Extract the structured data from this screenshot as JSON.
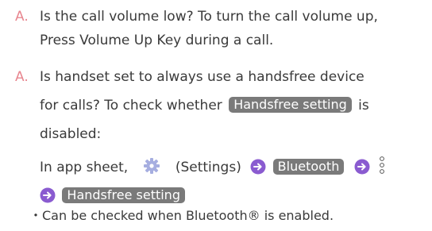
{
  "qa": [
    {
      "marker": "A.",
      "line1": "Is the call volume low? To turn the call volume up,",
      "line2": "Press Volume Up Key during a call."
    },
    {
      "marker": "A.",
      "line1": "Is handset set to always use a handsfree device",
      "line2a": "for calls? To check whether",
      "tag_handsfree": "Handsfree setting",
      "line2b": "is",
      "line3": "disabled:",
      "steps_prefix": "In app sheet,",
      "settings_label": "(Settings)",
      "tag_bluetooth": "Bluetooth",
      "tag_handsfree2": "Handsfree setting",
      "note": "・Can be checked when Bluetooth® is enabled."
    }
  ],
  "colors": {
    "marker": "#e88790",
    "tag_bg": "#7a7a7a",
    "arrow": "#8a5bd0",
    "gear": "#a6aee0"
  },
  "icons": [
    "gear-icon",
    "arrow-right-icon",
    "more-vertical-icon"
  ]
}
